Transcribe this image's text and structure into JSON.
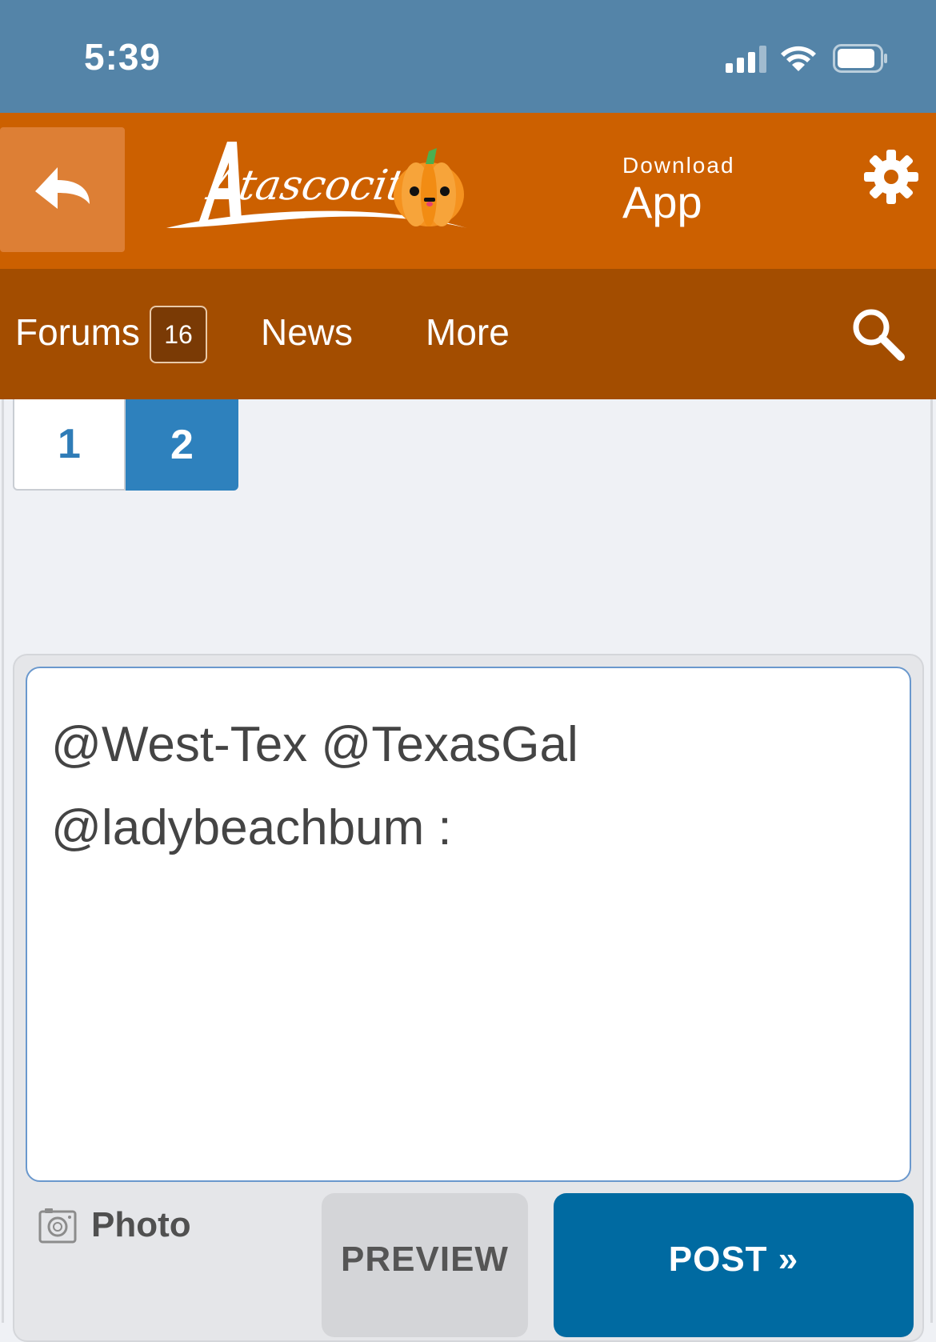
{
  "status_bar": {
    "time": "5:39"
  },
  "header": {
    "logo_text": "Atascocita",
    "download_small": "Download",
    "download_big": "App",
    "accent_color": "#cc6000"
  },
  "nav": {
    "items": [
      {
        "label": "Forums",
        "badge": "16"
      },
      {
        "label": "News"
      },
      {
        "label": "More"
      }
    ],
    "bar_color": "#a34d00"
  },
  "pagination": {
    "pages": [
      "1",
      "2"
    ],
    "current": "2"
  },
  "composer": {
    "line1": "@West-Tex  @TexasGal",
    "line2": "@ladybeachbum  :",
    "photo_label": "Photo",
    "preview_label": "PREVIEW",
    "post_label": "POST »",
    "post_color": "#006aa1"
  }
}
